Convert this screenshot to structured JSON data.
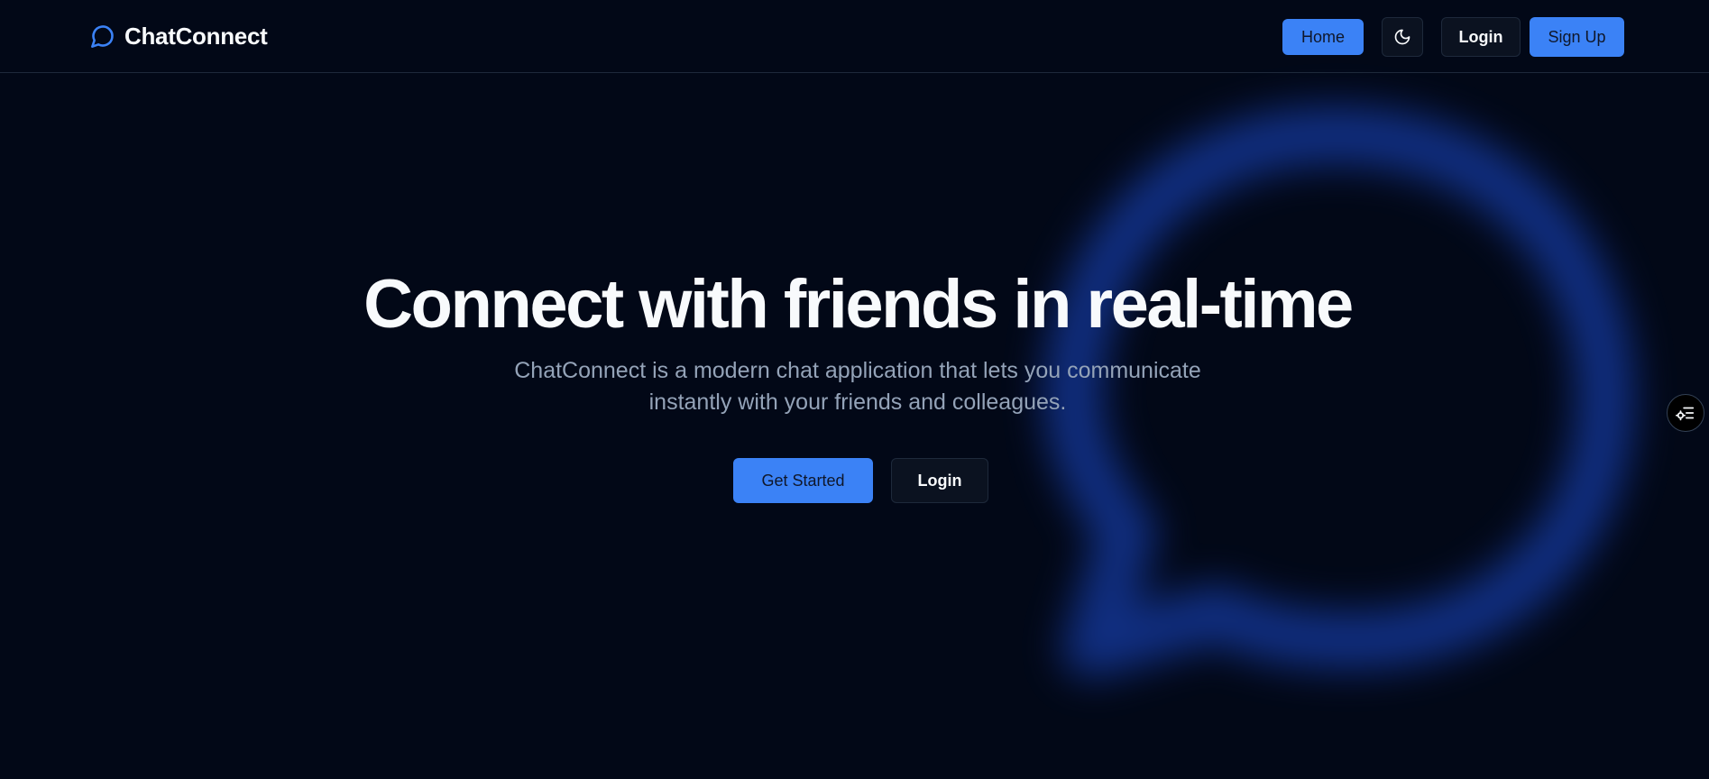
{
  "brand": {
    "name": "ChatConnect",
    "icon": "chat-bubble-icon",
    "accent_color": "#3b82f6"
  },
  "nav": {
    "home_label": "Home",
    "theme_toggle_icon": "moon-icon",
    "login_label": "Login",
    "signup_label": "Sign Up"
  },
  "hero": {
    "title": "Connect with friends in real-time",
    "subtitle": "ChatConnect is a modern chat application that lets you communicate instantly with your friends and colleagues.",
    "primary_cta": "Get Started",
    "secondary_cta": "Login"
  },
  "side_widget": {
    "icon": "settings-list-icon"
  },
  "colors": {
    "background": "#020817",
    "accent": "#3b82f6",
    "text": "#f8fafc",
    "muted_text": "#94a3b8",
    "border": "#1e293b"
  }
}
